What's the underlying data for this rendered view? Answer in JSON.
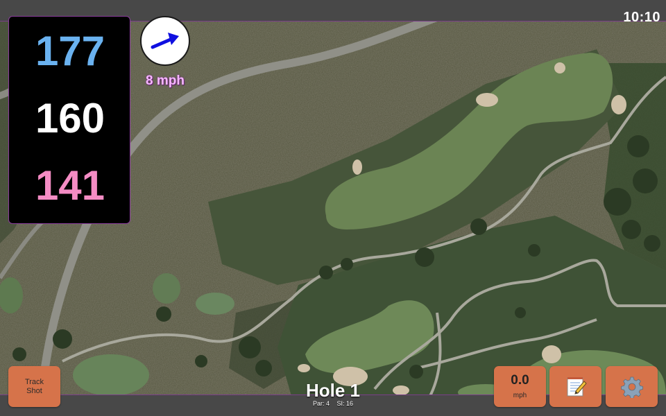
{
  "status_bar": {
    "time": "10:10"
  },
  "distances": {
    "back": "177",
    "center": "160",
    "front": "141",
    "colors": {
      "back": "#6ab2f0",
      "center": "#ffffff",
      "front": "#f48cc4"
    }
  },
  "wind": {
    "speed_label": "8 mph",
    "direction_icon": "arrow-right-up-icon"
  },
  "buttons": {
    "track_shot": "Track Shot",
    "wind_value": "0.0",
    "wind_unit": "mph",
    "scorecard_icon": "notepad-icon",
    "settings_icon": "gear-icon"
  },
  "hole": {
    "title": "Hole 1",
    "par": "Par: 4",
    "stroke_index": "SI: 16"
  },
  "colors": {
    "accent": "#d6734a",
    "panel_border": "#8a3c9c"
  }
}
